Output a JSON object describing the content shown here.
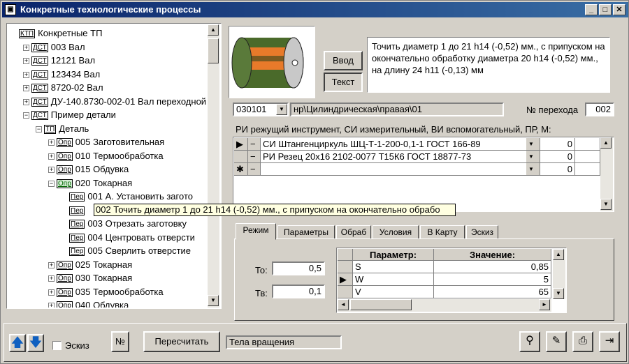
{
  "window": {
    "title": "Конкретные технологические процессы"
  },
  "tree": {
    "items": [
      {
        "tag": "КТП",
        "label": "Конкретные ТП",
        "level": 0,
        "exp": ""
      },
      {
        "tag": "ДСТ",
        "label": "003 Вал",
        "level": 1,
        "exp": "+"
      },
      {
        "tag": "ДСТ",
        "label": "12121 Вал",
        "level": 1,
        "exp": "+"
      },
      {
        "tag": "ДСТ",
        "label": "123434 Вал",
        "level": 1,
        "exp": "+"
      },
      {
        "tag": "ДСТ",
        "label": "8720-02 Вал",
        "level": 1,
        "exp": "+"
      },
      {
        "tag": "ДСТ",
        "label": "ДУ-140.8730-002-01 Вал переходной",
        "level": 1,
        "exp": "+"
      },
      {
        "tag": "ДСТ",
        "label": "Пример детали",
        "level": 1,
        "exp": "−"
      },
      {
        "tag": "ТП",
        "label": "Деталь",
        "level": 2,
        "exp": "−"
      },
      {
        "tag": "Опр",
        "label": "005 Заготовительная",
        "level": 3,
        "exp": "+"
      },
      {
        "tag": "Опр",
        "label": "010 Термообработка",
        "level": 3,
        "exp": "+"
      },
      {
        "tag": "Опр",
        "label": "015 Обдувка",
        "level": 3,
        "exp": "+"
      },
      {
        "tag": "Опр",
        "label": "020 Токарная",
        "level": 3,
        "exp": "−",
        "sel": true
      },
      {
        "tag": "Пер",
        "label": "001 А. Установить загото",
        "level": 4,
        "exp": ""
      },
      {
        "tag": "Пер",
        "label": "",
        "level": 4,
        "exp": ""
      },
      {
        "tag": "Пер",
        "label": "003 Отрезать заготовку",
        "level": 4,
        "exp": ""
      },
      {
        "tag": "Пер",
        "label": "004 Центровать отверсти",
        "level": 4,
        "exp": ""
      },
      {
        "tag": "Пер",
        "label": "005 Сверлить отверстие",
        "level": 4,
        "exp": ""
      },
      {
        "tag": "Опр",
        "label": "025 Токарная",
        "level": 3,
        "exp": "+"
      },
      {
        "tag": "Опр",
        "label": "030 Токарная",
        "level": 3,
        "exp": "+"
      },
      {
        "tag": "Опр",
        "label": "035 Термообработка",
        "level": 3,
        "exp": "+"
      },
      {
        "tag": "Опр",
        "label": "040 Обдувка",
        "level": 3,
        "exp": "+"
      }
    ]
  },
  "tooltip": "002 Точить диаметр 1 до 21 h14 (-0,52) мм., с припуском на окончательно обрабо",
  "description": "Точить диаметр 1 до 21 h14 (-0,52) мм., с припуском на окончательно обработку диаметра 20 h14 (-0,52) мм., на длину 24 h11 (-0,13) мм",
  "buttons": {
    "vvod": "Ввод",
    "tekst": "Текст",
    "recalc": "Пересчитать",
    "num": "№",
    "eskiz": "Эскиз"
  },
  "transition": {
    "code": "030101",
    "path": "нр\\Цилиндрическая\\правая\\01",
    "num_label": "№ перехода",
    "num_value": "002"
  },
  "tools_label": "РИ режущий инструмент, СИ измерительный, ВИ вспомогательный, ПР, М:",
  "tools": [
    {
      "name": "СИ Штангенциркуль ШЦ-Т-1-200-0,1-1 ГОСТ 166-89",
      "qty": "0"
    },
    {
      "name": "РИ Резец 20х16 2102-0077 Т15К6 ГОСТ 18877-73",
      "qty": "0"
    },
    {
      "name": "",
      "qty": "0"
    }
  ],
  "tabs": [
    "Режим",
    "Параметры",
    "Обраб",
    "Условия",
    "В Карту",
    "Эскиз"
  ],
  "mode": {
    "to_label": "То:",
    "to_value": "0,5",
    "tv_label": "Тв:",
    "tv_value": "0,1"
  },
  "params": {
    "head_param": "Параметр:",
    "head_value": "Значение:",
    "rows": [
      {
        "param": "S",
        "value": "0,85"
      },
      {
        "param": "W",
        "value": "5"
      },
      {
        "param": "V",
        "value": "65"
      }
    ]
  },
  "status": "Тела вращения",
  "colors": {
    "title_start": "#0a246a",
    "title_end": "#3a6ea5",
    "tooltip_bg": "#ffffe1",
    "part_orange": "#e87a2a",
    "part_green": "#4a6a2a"
  }
}
